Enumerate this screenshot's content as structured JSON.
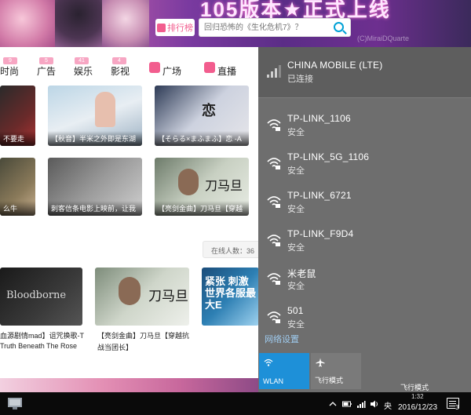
{
  "banner": {
    "title": "105版本★正式上线",
    "rank_label": "排行榜",
    "search_placeholder": "回归恐怖的《生化危机7》？",
    "watermark": "(C)MiraiDQuarte"
  },
  "nav": {
    "items": [
      {
        "label": "时尚",
        "badge": "9"
      },
      {
        "label": "广告",
        "badge": "5"
      },
      {
        "label": "娱乐",
        "badge": "41"
      },
      {
        "label": "影视",
        "badge": "4"
      },
      {
        "label": "广场",
        "badge": ""
      },
      {
        "label": "直播",
        "badge": ""
      }
    ]
  },
  "videos": {
    "row1": [
      {
        "caption": "不要走"
      },
      {
        "caption": "【秋音】半米之外即是东湖"
      },
      {
        "caption": "【そらる×まふまふ】恋 -A"
      }
    ],
    "row2": [
      {
        "caption": "么牛"
      },
      {
        "caption": "刺客信条电影上映前，让我"
      },
      {
        "caption": "【亮剑金曲】刀马旦【穿越"
      }
    ],
    "row3": [
      {
        "thumb_text": "Bloodborne",
        "title1": "血源剧情mad】诅咒换歌-T",
        "title2": "Truth Beneath The Rose"
      },
      {
        "thumb_text": "刀马旦",
        "title1": "【亮剑金曲】刀马旦【穿越抗",
        "title2": "战当团长】"
      },
      {
        "thumb_text": "紧张 刺激 世界各服最 大E",
        "title1": "",
        "title2": ""
      }
    ],
    "thumb_text_row2": "刀马旦",
    "thumb_text_row1": "恋",
    "online_label": "在线人数：36"
  },
  "wifi": {
    "connected": {
      "name": "CHINA MOBILE (LTE)",
      "status": "已连接"
    },
    "networks": [
      {
        "name": "TP-LINK_1106",
        "status": "安全"
      },
      {
        "name": "TP-LINK_5G_1106",
        "status": "安全"
      },
      {
        "name": "TP-LINK_6721",
        "status": "安全"
      },
      {
        "name": "TP-LINK_F9D4",
        "status": "安全"
      },
      {
        "name": "米老鼠",
        "status": "安全"
      },
      {
        "name": "501",
        "status": "安全"
      }
    ],
    "settings_link": "网络设置",
    "quick_actions": [
      {
        "label": "WLAN",
        "active": true,
        "color": "#1e90d8"
      },
      {
        "label": "飞行模式",
        "active": false,
        "color": "#7a7a7a"
      }
    ],
    "tooltip": "飞行模式"
  },
  "taskbar": {
    "ime": "央",
    "time": "1:32",
    "date": "2016/12/23",
    "notification_count": "3"
  }
}
